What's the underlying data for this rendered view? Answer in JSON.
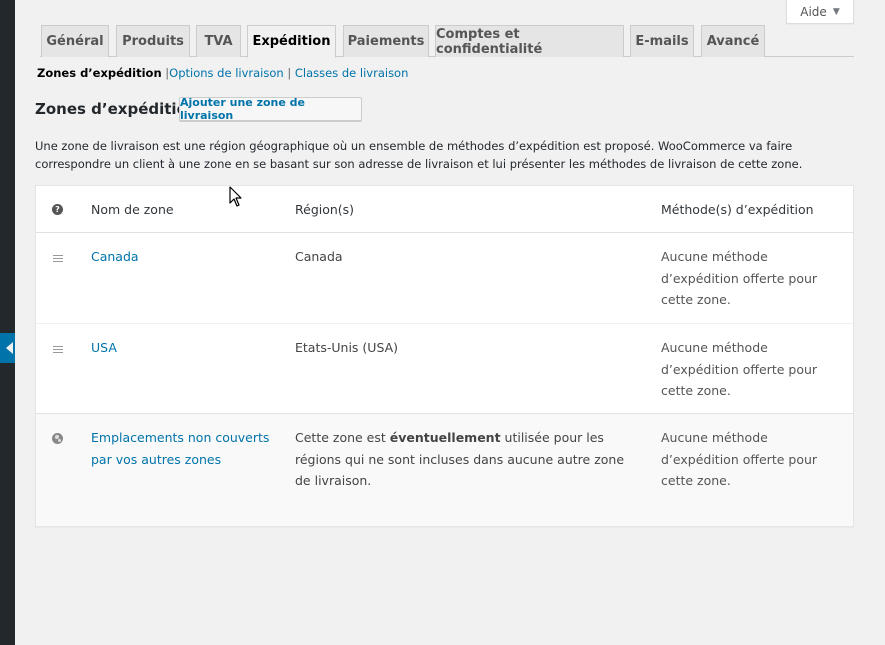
{
  "help_tab": {
    "label": "Aide",
    "icon": "caret-down-icon"
  },
  "tabs": [
    {
      "label": "Général",
      "active": false
    },
    {
      "label": "Produits",
      "active": false
    },
    {
      "label": "TVA",
      "active": false
    },
    {
      "label": "Expédition",
      "active": true
    },
    {
      "label": "Paiements",
      "active": false
    },
    {
      "label": "Comptes et confidentialité",
      "active": false
    },
    {
      "label": "E-mails",
      "active": false
    },
    {
      "label": "Avancé",
      "active": false
    }
  ],
  "subnav": {
    "current": "Zones d’expédition",
    "separator": "|",
    "options": "Options de livraison",
    "classes": "Classes de livraison"
  },
  "page": {
    "title": "Zones d’expédition",
    "add_zone_button": "Ajouter une zone de livraison",
    "description": "Une zone de livraison est une région géographique où un ensemble de méthodes d’expédition est proposé. WooCommerce va faire correspondre un client à une zone en se basant sur son adresse de livraison et lui présenter les méthodes de livraison de cette zone."
  },
  "table": {
    "headers": {
      "name": "Nom de zone",
      "regions": "Région(s)",
      "methods": "Méthode(s) d’expédition"
    },
    "rows": [
      {
        "name": "Canada",
        "regions": "Canada",
        "methods": "Aucune méthode d’expédition offerte pour cette zone."
      },
      {
        "name": "USA",
        "regions": "Etats-Unis (USA)",
        "methods": "Aucune méthode d’expédition offerte pour cette zone."
      }
    ],
    "rest_of_world": {
      "name": "Emplacements non couverts par vos autres zones",
      "regions_before": "Cette zone est ",
      "regions_bold": "éventuellement",
      "regions_after": " utilisée pour les régions qui ne sont incluses dans aucune autre zone de livraison.",
      "methods": "Aucune méthode d’expédition offerte pour cette zone."
    }
  },
  "colors": {
    "link": "#0073aa",
    "sidebar": "#23282d",
    "background": "#f1f1f1"
  }
}
